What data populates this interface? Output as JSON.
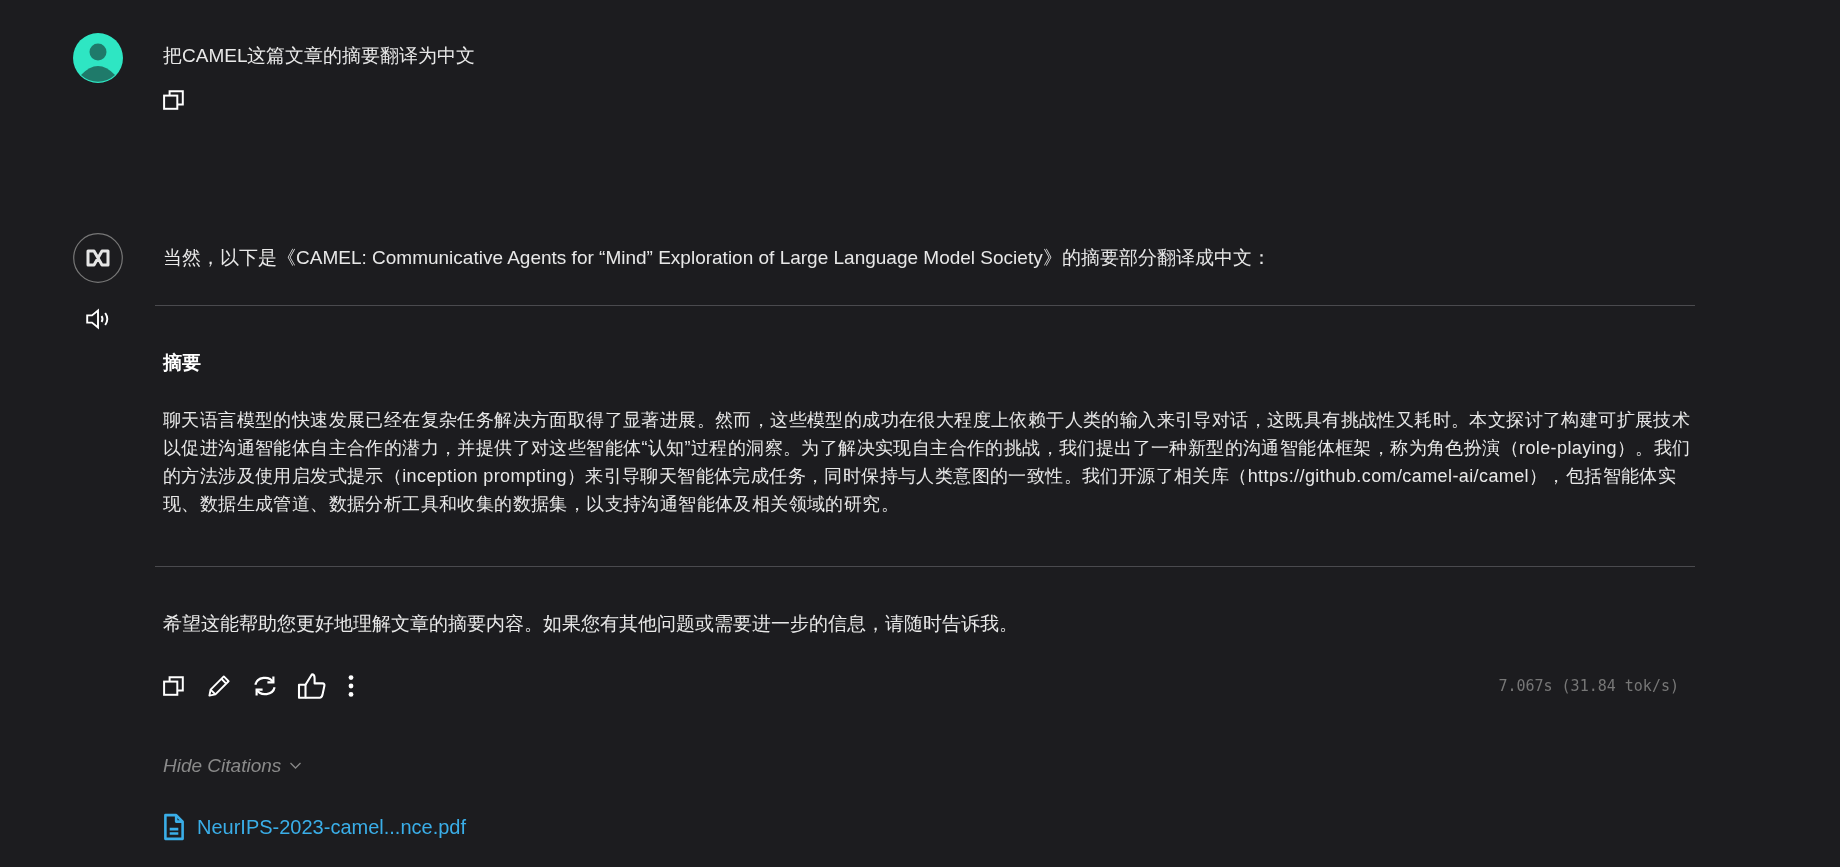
{
  "messages": [
    {
      "kind": "user",
      "text": "把CAMEL这篇文章的摘要翻译为中文"
    },
    {
      "kind": "assistant",
      "intro": "当然，以下是《CAMEL: Communicative Agents for “Mind” Exploration of Large Language Model Society》的摘要部分翻译成中文：",
      "heading": "摘要",
      "paragraph": "聊天语言模型的快速发展已经在复杂任务解决方面取得了显著进展。然而，这些模型的成功在很大程度上依赖于人类的输入来引导对话，这既具有挑战性又耗时。本文探讨了构建可扩展技术以促进沟通智能体自主合作的潜力，并提供了对这些智能体“认知”过程的洞察。为了解决实现自主合作的挑战，我们提出了一种新型的沟通智能体框架，称为角色扮演（role-playing）。我们的方法涉及使用启发式提示（inception prompting）来引导聊天智能体完成任务，同时保持与人类意图的一致性。我们开源了相关库（https://github.com/camel-ai/camel），包括智能体实现、数据生成管道、数据分析工具和收集的数据集，以支持沟通智能体及相关领域的研究。",
      "closing": "希望这能帮助您更好地理解文章的摘要内容。如果您有其他问题或需要进一步的信息，请随时告诉我。",
      "timing": "7.067s (31.84 tok/s)",
      "citations_toggle": "Hide Citations",
      "citations_expanded": true,
      "citations": [
        "NeurIPS-2023-camel...nce.pdf"
      ]
    }
  ]
}
